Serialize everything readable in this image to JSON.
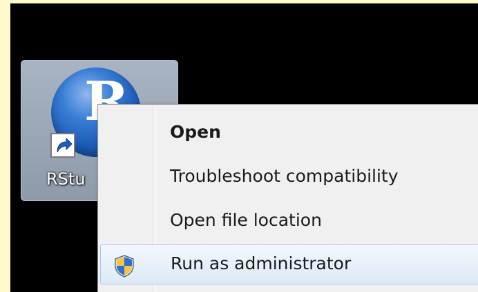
{
  "desktop": {
    "shortcut": {
      "label": "RStu",
      "logo_letter": "R",
      "icon": "r-logo-icon",
      "overlay_icon": "shortcut-arrow-icon"
    }
  },
  "context_menu": {
    "items": [
      {
        "label": "Open",
        "bold": true
      },
      {
        "label": "Troubleshoot compatibility"
      },
      {
        "label": "Open file location"
      },
      {
        "label": "Run as administrator",
        "icon": "uac-shield-icon",
        "highlighted": true
      }
    ]
  },
  "colors": {
    "page_background": "#fffacd",
    "desktop_background": "#000000",
    "menu_background": "#f0f0f0",
    "highlight": "#dceaf8"
  }
}
